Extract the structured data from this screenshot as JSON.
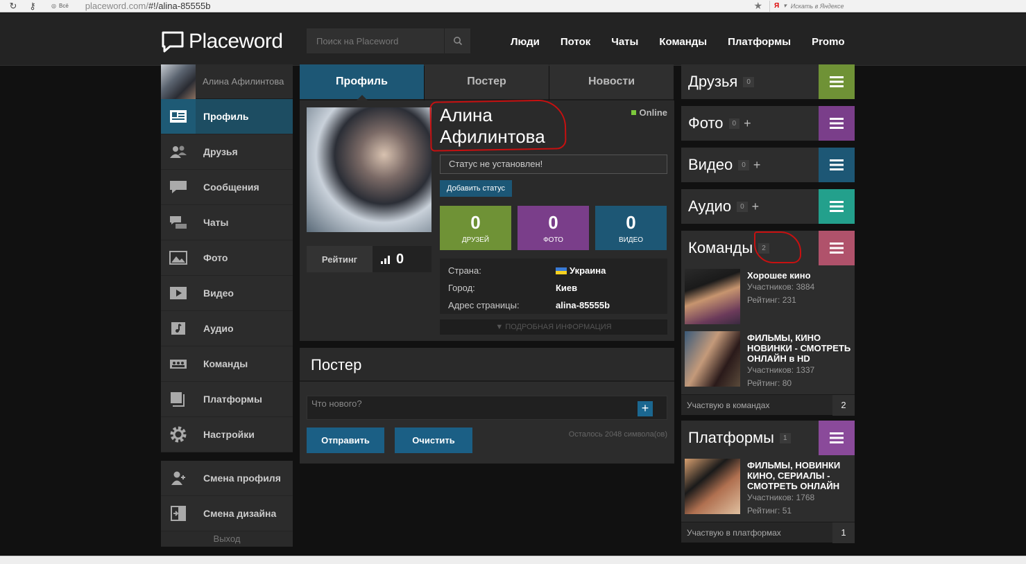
{
  "browser": {
    "tab_label": "Всё",
    "url_prefix": "placeword.com/",
    "url_path": "#!/alina-85555b",
    "search_hint": "Искать в Яндексе",
    "ya": "Я"
  },
  "header": {
    "logo": "Placeword",
    "search_placeholder": "Поиск на Placeword",
    "nav": [
      "Люди",
      "Поток",
      "Чаты",
      "Команды",
      "Платформы",
      "Promo"
    ]
  },
  "sidebar": {
    "user_name": "Алина Афилинтова",
    "items": [
      {
        "label": "Профиль",
        "icon": "profile-card-icon",
        "active": true
      },
      {
        "label": "Друзья",
        "icon": "friends-icon",
        "active": false
      },
      {
        "label": "Сообщения",
        "icon": "message-bubble-icon",
        "active": false
      },
      {
        "label": "Чаты",
        "icon": "chat-bubbles-icon",
        "active": false
      },
      {
        "label": "Фото",
        "icon": "photo-icon",
        "active": false
      },
      {
        "label": "Видео",
        "icon": "video-play-icon",
        "active": false
      },
      {
        "label": "Аудио",
        "icon": "music-note-icon",
        "active": false
      },
      {
        "label": "Команды",
        "icon": "team-icon",
        "active": false
      },
      {
        "label": "Платформы",
        "icon": "platforms-icon",
        "active": false
      },
      {
        "label": "Настройки",
        "icon": "gear-icon",
        "active": false
      }
    ],
    "secondary": [
      {
        "label": "Смена профиля",
        "icon": "switch-profile-icon"
      },
      {
        "label": "Смена дизайна",
        "icon": "switch-design-icon"
      }
    ],
    "logout": "Выход"
  },
  "center": {
    "tabs": [
      "Профиль",
      "Постер",
      "Новости"
    ],
    "profile": {
      "name": "Алина Афилинтова",
      "online": "Online",
      "status": "Статус не установлен!",
      "add_status": "Добавить статус",
      "rating_label": "Рейтинг",
      "rating_value": "0",
      "stats": [
        {
          "value": "0",
          "label": "ДРУЗЕЙ",
          "color": "#6f9236"
        },
        {
          "value": "0",
          "label": "ФОТО",
          "color": "#7a3e8a"
        },
        {
          "value": "0",
          "label": "ВИДЕО",
          "color": "#1d5775"
        }
      ],
      "info": [
        {
          "key": "Страна:",
          "value": "Украина"
        },
        {
          "key": "Город:",
          "value": "Киев"
        },
        {
          "key": "Адрес страницы:",
          "value": "alina-85555b"
        }
      ],
      "more": "▼ ПОДРОБНАЯ ИНФОРМАЦИЯ"
    },
    "poster": {
      "title": "Постер",
      "placeholder": "Что нового?",
      "plus": "+",
      "send": "Отправить",
      "clear": "Очистить",
      "chars_left": "Осталось 2048 символа(ов)"
    }
  },
  "right": {
    "widgets": [
      {
        "title": "Друзья",
        "count": "0",
        "plus": "",
        "color": "#6f9236"
      },
      {
        "title": "Фото",
        "count": "0",
        "plus": "+",
        "color": "#7a3e8a"
      },
      {
        "title": "Видео",
        "count": "0",
        "plus": "+",
        "color": "#1d5775"
      },
      {
        "title": "Аудио",
        "count": "0",
        "plus": "+",
        "color": "#23a08c"
      }
    ],
    "teams": {
      "title": "Команды",
      "count": "2",
      "color": "#b0526b",
      "items": [
        {
          "name": "Хорошее кино",
          "members": "Участников: 3884",
          "rating": "Рейтинг: 231"
        },
        {
          "name": "ФИЛЬМЫ, КИНО НОВИНКИ - СМОТРЕТЬ ОНЛАЙН в HD",
          "members": "Участников: 1337",
          "rating": "Рейтинг: 80"
        }
      ],
      "footer": "Участвую в командах",
      "footer_count": "2"
    },
    "platforms": {
      "title": "Платформы",
      "count": "1",
      "color": "#8a4a9a",
      "items": [
        {
          "name": "ФИЛЬМЫ, НОВИНКИ КИНО, СЕРИАЛЫ - СМОТРЕТЬ ОНЛАЙН",
          "members": "Участников: 1768",
          "rating": "Рейтинг: 51"
        }
      ],
      "footer": "Участвую в платформах",
      "footer_count": "1"
    }
  }
}
